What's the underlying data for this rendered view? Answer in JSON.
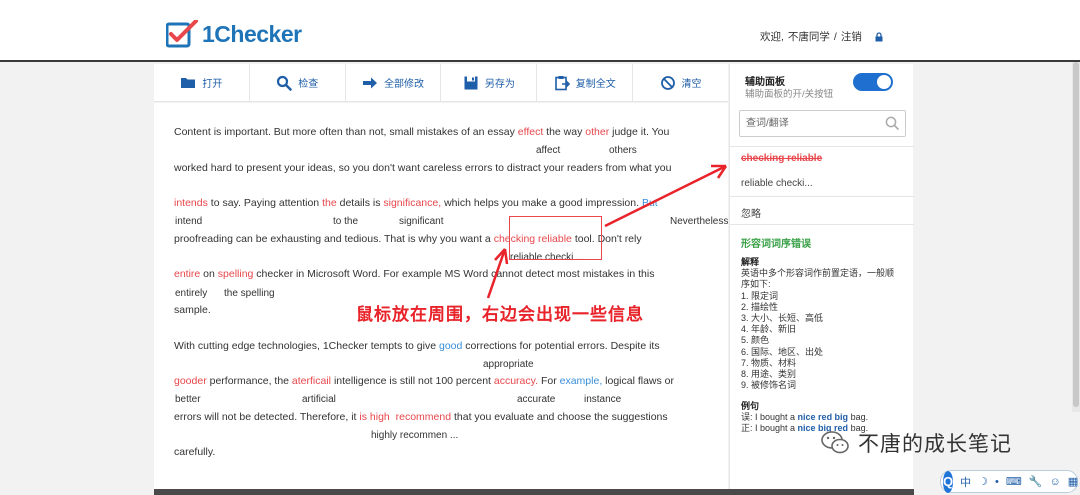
{
  "header": {
    "logo_text": "1Checker",
    "welcome": "欢迎,",
    "username": "不唐同学",
    "separator": "/",
    "logout": "注销"
  },
  "toolbar": {
    "open": "打开",
    "check": "检查",
    "fix_all": "全部修改",
    "save_as": "另存为",
    "copy_all": "复制全文",
    "clear": "清空"
  },
  "editor": {
    "p1": {
      "l1_a": "Content is important. But more often than not, small mistakes of an essay ",
      "l1_e1": "effect",
      "l1_b": " the way ",
      "l1_e2": "other",
      "l1_c": " judge it. You",
      "s1": "affect",
      "s2": "others",
      "l2": "worked hard to present your ideas, so you don't want careless errors to distract your readers from what you",
      "l3_e1": "intends",
      "l3_a": " to say. Paying attention ",
      "l3_e2": "the",
      "l3_b": " details is ",
      "l3_e3": "significance,",
      "l3_c": " which helps you make a good impression. ",
      "l3_e4": "But",
      "s3": "intend",
      "s4": "to the",
      "s5": "significant",
      "s6": "Nevertheless,",
      "l4_a": "proofreading can be exhausting and tedious. That is why you want a ",
      "l4_e1": "checking reliable",
      "l4_b": " tool. Don't rely",
      "s7": "reliable checki ...",
      "l5_e1": "entire",
      "l5_a": " on ",
      "l5_e2": "spelling",
      "l5_b": " checker in Microsoft Word. For example MS Word cannot detect most mistakes in this",
      "s8": "entirely",
      "s9": "the spelling",
      "l6": "sample."
    },
    "p2": {
      "l1_a": "With cutting edge technologies, 1Checker tempts to give ",
      "l1_e1": "good",
      "l1_b": " corrections for potential errors. Despite its",
      "s1": "appropriate",
      "l2_e1": "gooder",
      "l2_a": " performance, the ",
      "l2_e2": "aterficail",
      "l2_b": " intelligence is still not 100 percent ",
      "l2_e3": "accuracy.",
      "l2_c": " For ",
      "l2_e4": "example,",
      "l2_d": " logical flaws or",
      "s2": "better",
      "s3": "artificial",
      "s4": "accurate",
      "s5": "instance",
      "l3_a": "errors will not be detected. Therefore, it ",
      "l3_e1": "is high",
      "l3_sp": "  ",
      "l3_e2": "recommend",
      "l3_b": " that you evaluate and choose the suggestions",
      "s6": "highly recommen ...",
      "l4": "carefully."
    },
    "annotation": "鼠标放在周围，右边会出现一些信息"
  },
  "side_panel": {
    "title": "辅助面板",
    "subtitle": "辅助面板的开/关按钮",
    "search_placeholder": "查词/翻译",
    "error_phrase": "checking reliable",
    "suggestion": "reliable checki...",
    "ignore": "忽略",
    "category": "形容词词序错误",
    "explain_head": "解释",
    "explain_intro_1": "英语中多个形容词作前置定语，一般顺",
    "explain_intro_2": "序如下:",
    "rules": [
      "1. 限定词",
      "2. 描绘性",
      "3. 大小、长短、高低",
      "4. 年龄、新旧",
      "5. 颜色",
      "6. 国际、地区、出处",
      "7. 物质、材料",
      "8. 用途、类别",
      "9. 被修饰名词"
    ],
    "example_head": "例句",
    "ex_wrong_label": "误: I bought a ",
    "ex_wrong_hl": "nice red big",
    "ex_wrong_end": " bag.",
    "ex_right_label": "正: I bought a ",
    "ex_right_hl": "nice big red",
    "ex_right_end": " bag."
  },
  "watermark": "不唐的成长笔记",
  "ime": {
    "logo": "Q",
    "lang": "中"
  },
  "colors": {
    "brand_blue": "#1f74b8",
    "error_red": "#e8474b",
    "toggle_blue": "#1f6fd0",
    "category_green": "#3aa148"
  }
}
